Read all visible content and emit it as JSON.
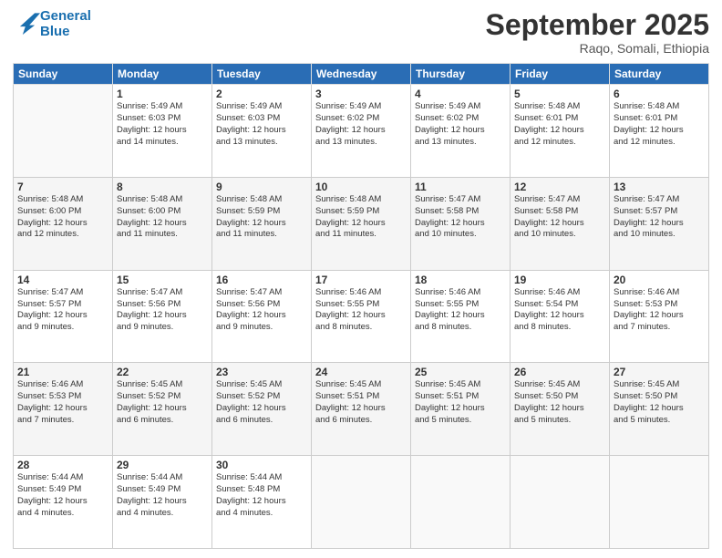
{
  "header": {
    "logo_line1": "General",
    "logo_line2": "Blue",
    "month": "September 2025",
    "location": "Raqo, Somali, Ethiopia"
  },
  "days_of_week": [
    "Sunday",
    "Monday",
    "Tuesday",
    "Wednesday",
    "Thursday",
    "Friday",
    "Saturday"
  ],
  "weeks": [
    [
      {
        "day": "",
        "info": ""
      },
      {
        "day": "1",
        "info": "Sunrise: 5:49 AM\nSunset: 6:03 PM\nDaylight: 12 hours\nand 14 minutes."
      },
      {
        "day": "2",
        "info": "Sunrise: 5:49 AM\nSunset: 6:03 PM\nDaylight: 12 hours\nand 13 minutes."
      },
      {
        "day": "3",
        "info": "Sunrise: 5:49 AM\nSunset: 6:02 PM\nDaylight: 12 hours\nand 13 minutes."
      },
      {
        "day": "4",
        "info": "Sunrise: 5:49 AM\nSunset: 6:02 PM\nDaylight: 12 hours\nand 13 minutes."
      },
      {
        "day": "5",
        "info": "Sunrise: 5:48 AM\nSunset: 6:01 PM\nDaylight: 12 hours\nand 12 minutes."
      },
      {
        "day": "6",
        "info": "Sunrise: 5:48 AM\nSunset: 6:01 PM\nDaylight: 12 hours\nand 12 minutes."
      }
    ],
    [
      {
        "day": "7",
        "info": "Sunrise: 5:48 AM\nSunset: 6:00 PM\nDaylight: 12 hours\nand 12 minutes."
      },
      {
        "day": "8",
        "info": "Sunrise: 5:48 AM\nSunset: 6:00 PM\nDaylight: 12 hours\nand 11 minutes."
      },
      {
        "day": "9",
        "info": "Sunrise: 5:48 AM\nSunset: 5:59 PM\nDaylight: 12 hours\nand 11 minutes."
      },
      {
        "day": "10",
        "info": "Sunrise: 5:48 AM\nSunset: 5:59 PM\nDaylight: 12 hours\nand 11 minutes."
      },
      {
        "day": "11",
        "info": "Sunrise: 5:47 AM\nSunset: 5:58 PM\nDaylight: 12 hours\nand 10 minutes."
      },
      {
        "day": "12",
        "info": "Sunrise: 5:47 AM\nSunset: 5:58 PM\nDaylight: 12 hours\nand 10 minutes."
      },
      {
        "day": "13",
        "info": "Sunrise: 5:47 AM\nSunset: 5:57 PM\nDaylight: 12 hours\nand 10 minutes."
      }
    ],
    [
      {
        "day": "14",
        "info": "Sunrise: 5:47 AM\nSunset: 5:57 PM\nDaylight: 12 hours\nand 9 minutes."
      },
      {
        "day": "15",
        "info": "Sunrise: 5:47 AM\nSunset: 5:56 PM\nDaylight: 12 hours\nand 9 minutes."
      },
      {
        "day": "16",
        "info": "Sunrise: 5:47 AM\nSunset: 5:56 PM\nDaylight: 12 hours\nand 9 minutes."
      },
      {
        "day": "17",
        "info": "Sunrise: 5:46 AM\nSunset: 5:55 PM\nDaylight: 12 hours\nand 8 minutes."
      },
      {
        "day": "18",
        "info": "Sunrise: 5:46 AM\nSunset: 5:55 PM\nDaylight: 12 hours\nand 8 minutes."
      },
      {
        "day": "19",
        "info": "Sunrise: 5:46 AM\nSunset: 5:54 PM\nDaylight: 12 hours\nand 8 minutes."
      },
      {
        "day": "20",
        "info": "Sunrise: 5:46 AM\nSunset: 5:53 PM\nDaylight: 12 hours\nand 7 minutes."
      }
    ],
    [
      {
        "day": "21",
        "info": "Sunrise: 5:46 AM\nSunset: 5:53 PM\nDaylight: 12 hours\nand 7 minutes."
      },
      {
        "day": "22",
        "info": "Sunrise: 5:45 AM\nSunset: 5:52 PM\nDaylight: 12 hours\nand 6 minutes."
      },
      {
        "day": "23",
        "info": "Sunrise: 5:45 AM\nSunset: 5:52 PM\nDaylight: 12 hours\nand 6 minutes."
      },
      {
        "day": "24",
        "info": "Sunrise: 5:45 AM\nSunset: 5:51 PM\nDaylight: 12 hours\nand 6 minutes."
      },
      {
        "day": "25",
        "info": "Sunrise: 5:45 AM\nSunset: 5:51 PM\nDaylight: 12 hours\nand 5 minutes."
      },
      {
        "day": "26",
        "info": "Sunrise: 5:45 AM\nSunset: 5:50 PM\nDaylight: 12 hours\nand 5 minutes."
      },
      {
        "day": "27",
        "info": "Sunrise: 5:45 AM\nSunset: 5:50 PM\nDaylight: 12 hours\nand 5 minutes."
      }
    ],
    [
      {
        "day": "28",
        "info": "Sunrise: 5:44 AM\nSunset: 5:49 PM\nDaylight: 12 hours\nand 4 minutes."
      },
      {
        "day": "29",
        "info": "Sunrise: 5:44 AM\nSunset: 5:49 PM\nDaylight: 12 hours\nand 4 minutes."
      },
      {
        "day": "30",
        "info": "Sunrise: 5:44 AM\nSunset: 5:48 PM\nDaylight: 12 hours\nand 4 minutes."
      },
      {
        "day": "",
        "info": ""
      },
      {
        "day": "",
        "info": ""
      },
      {
        "day": "",
        "info": ""
      },
      {
        "day": "",
        "info": ""
      }
    ]
  ]
}
